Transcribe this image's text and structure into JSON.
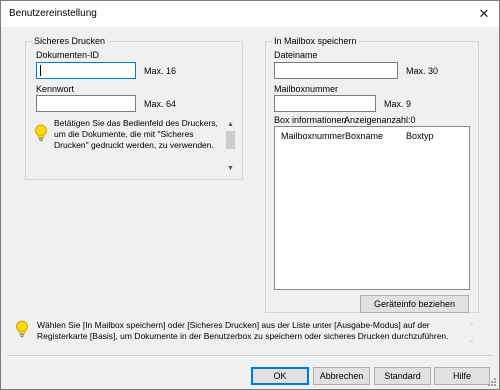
{
  "window": {
    "title": "Benutzereinstellung",
    "close_glyph": "✕"
  },
  "secure_print": {
    "group_label": "Sicheres Drucken",
    "doc_id_label": "Dokumenten-ID",
    "doc_id_value": "",
    "doc_id_max": "Max. 16",
    "password_label": "Kennwort",
    "password_value": "",
    "password_max": "Max. 64",
    "info_text": "Betätigen Sie das Bedienfeld des Druckers, um die Dokumente, die mit \"Sicheres Drucken\" gedruckt werden, zu verwenden.",
    "info_icon": "lightbulb-icon"
  },
  "mailbox": {
    "group_label": "In Mailbox speichern",
    "filename_label": "Dateiname",
    "filename_value": "",
    "filename_max": "Max. 30",
    "boxnumber_label": "Mailboxnummer",
    "boxnumber_value": "",
    "boxnumber_max": "Max. 9",
    "box_info_label": "Box informationen",
    "display_count_label": "Anzeigenanzahl:0",
    "columns": [
      "Mailboxnummer",
      "Boxname",
      "Boxtyp"
    ],
    "rows": [],
    "fetch_button": "Geräteinfo beziehen"
  },
  "footer": {
    "info_text": "Wählen Sie [In Mailbox speichern] oder [Sicheres Drucken] aus der Liste unter [Ausgabe-Modus] auf der Registerkarte [Basis], um Dokumente in der Benutzerbox zu speichern oder sicheres Drucken durchzuführen.",
    "info_icon": "lightbulb-icon"
  },
  "buttons": {
    "ok": "OK",
    "cancel": "Abbrechen",
    "default": "Standard",
    "help": "Hilfe"
  },
  "colors": {
    "dialog_bg": "#f0f0f0",
    "focus_border": "#0078d7",
    "icon_yellow": "#ffd800"
  }
}
